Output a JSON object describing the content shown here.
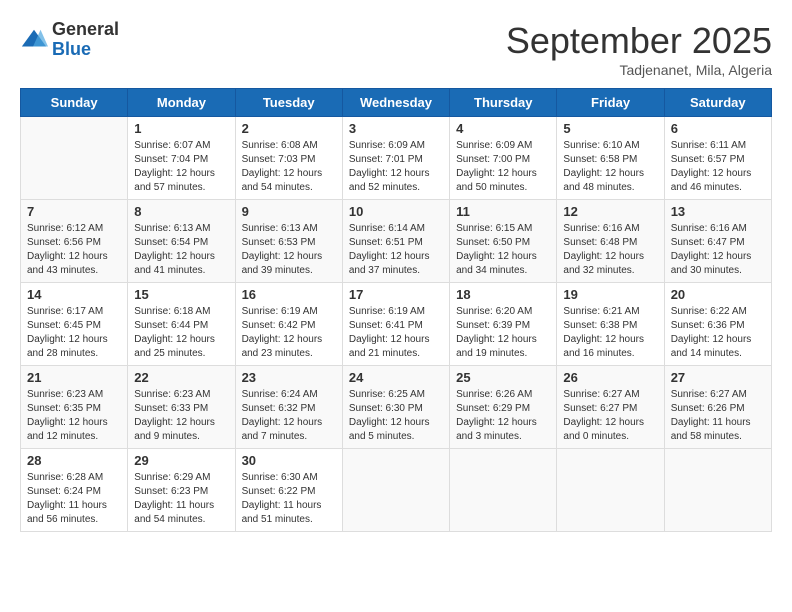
{
  "logo": {
    "general": "General",
    "blue": "Blue"
  },
  "title": "September 2025",
  "location": "Tadjenanet, Mila, Algeria",
  "days": [
    "Sunday",
    "Monday",
    "Tuesday",
    "Wednesday",
    "Thursday",
    "Friday",
    "Saturday"
  ],
  "weeks": [
    [
      {
        "day": null
      },
      {
        "day": "1",
        "sunrise": "6:07 AM",
        "sunset": "7:04 PM",
        "daylight": "12 hours and 57 minutes."
      },
      {
        "day": "2",
        "sunrise": "6:08 AM",
        "sunset": "7:03 PM",
        "daylight": "12 hours and 54 minutes."
      },
      {
        "day": "3",
        "sunrise": "6:09 AM",
        "sunset": "7:01 PM",
        "daylight": "12 hours and 52 minutes."
      },
      {
        "day": "4",
        "sunrise": "6:09 AM",
        "sunset": "7:00 PM",
        "daylight": "12 hours and 50 minutes."
      },
      {
        "day": "5",
        "sunrise": "6:10 AM",
        "sunset": "6:58 PM",
        "daylight": "12 hours and 48 minutes."
      },
      {
        "day": "6",
        "sunrise": "6:11 AM",
        "sunset": "6:57 PM",
        "daylight": "12 hours and 46 minutes."
      }
    ],
    [
      {
        "day": "7",
        "sunrise": "6:12 AM",
        "sunset": "6:56 PM",
        "daylight": "12 hours and 43 minutes."
      },
      {
        "day": "8",
        "sunrise": "6:13 AM",
        "sunset": "6:54 PM",
        "daylight": "12 hours and 41 minutes."
      },
      {
        "day": "9",
        "sunrise": "6:13 AM",
        "sunset": "6:53 PM",
        "daylight": "12 hours and 39 minutes."
      },
      {
        "day": "10",
        "sunrise": "6:14 AM",
        "sunset": "6:51 PM",
        "daylight": "12 hours and 37 minutes."
      },
      {
        "day": "11",
        "sunrise": "6:15 AM",
        "sunset": "6:50 PM",
        "daylight": "12 hours and 34 minutes."
      },
      {
        "day": "12",
        "sunrise": "6:16 AM",
        "sunset": "6:48 PM",
        "daylight": "12 hours and 32 minutes."
      },
      {
        "day": "13",
        "sunrise": "6:16 AM",
        "sunset": "6:47 PM",
        "daylight": "12 hours and 30 minutes."
      }
    ],
    [
      {
        "day": "14",
        "sunrise": "6:17 AM",
        "sunset": "6:45 PM",
        "daylight": "12 hours and 28 minutes."
      },
      {
        "day": "15",
        "sunrise": "6:18 AM",
        "sunset": "6:44 PM",
        "daylight": "12 hours and 25 minutes."
      },
      {
        "day": "16",
        "sunrise": "6:19 AM",
        "sunset": "6:42 PM",
        "daylight": "12 hours and 23 minutes."
      },
      {
        "day": "17",
        "sunrise": "6:19 AM",
        "sunset": "6:41 PM",
        "daylight": "12 hours and 21 minutes."
      },
      {
        "day": "18",
        "sunrise": "6:20 AM",
        "sunset": "6:39 PM",
        "daylight": "12 hours and 19 minutes."
      },
      {
        "day": "19",
        "sunrise": "6:21 AM",
        "sunset": "6:38 PM",
        "daylight": "12 hours and 16 minutes."
      },
      {
        "day": "20",
        "sunrise": "6:22 AM",
        "sunset": "6:36 PM",
        "daylight": "12 hours and 14 minutes."
      }
    ],
    [
      {
        "day": "21",
        "sunrise": "6:23 AM",
        "sunset": "6:35 PM",
        "daylight": "12 hours and 12 minutes."
      },
      {
        "day": "22",
        "sunrise": "6:23 AM",
        "sunset": "6:33 PM",
        "daylight": "12 hours and 9 minutes."
      },
      {
        "day": "23",
        "sunrise": "6:24 AM",
        "sunset": "6:32 PM",
        "daylight": "12 hours and 7 minutes."
      },
      {
        "day": "24",
        "sunrise": "6:25 AM",
        "sunset": "6:30 PM",
        "daylight": "12 hours and 5 minutes."
      },
      {
        "day": "25",
        "sunrise": "6:26 AM",
        "sunset": "6:29 PM",
        "daylight": "12 hours and 3 minutes."
      },
      {
        "day": "26",
        "sunrise": "6:27 AM",
        "sunset": "6:27 PM",
        "daylight": "12 hours and 0 minutes."
      },
      {
        "day": "27",
        "sunrise": "6:27 AM",
        "sunset": "6:26 PM",
        "daylight": "11 hours and 58 minutes."
      }
    ],
    [
      {
        "day": "28",
        "sunrise": "6:28 AM",
        "sunset": "6:24 PM",
        "daylight": "11 hours and 56 minutes."
      },
      {
        "day": "29",
        "sunrise": "6:29 AM",
        "sunset": "6:23 PM",
        "daylight": "11 hours and 54 minutes."
      },
      {
        "day": "30",
        "sunrise": "6:30 AM",
        "sunset": "6:22 PM",
        "daylight": "11 hours and 51 minutes."
      },
      {
        "day": null
      },
      {
        "day": null
      },
      {
        "day": null
      },
      {
        "day": null
      }
    ]
  ]
}
